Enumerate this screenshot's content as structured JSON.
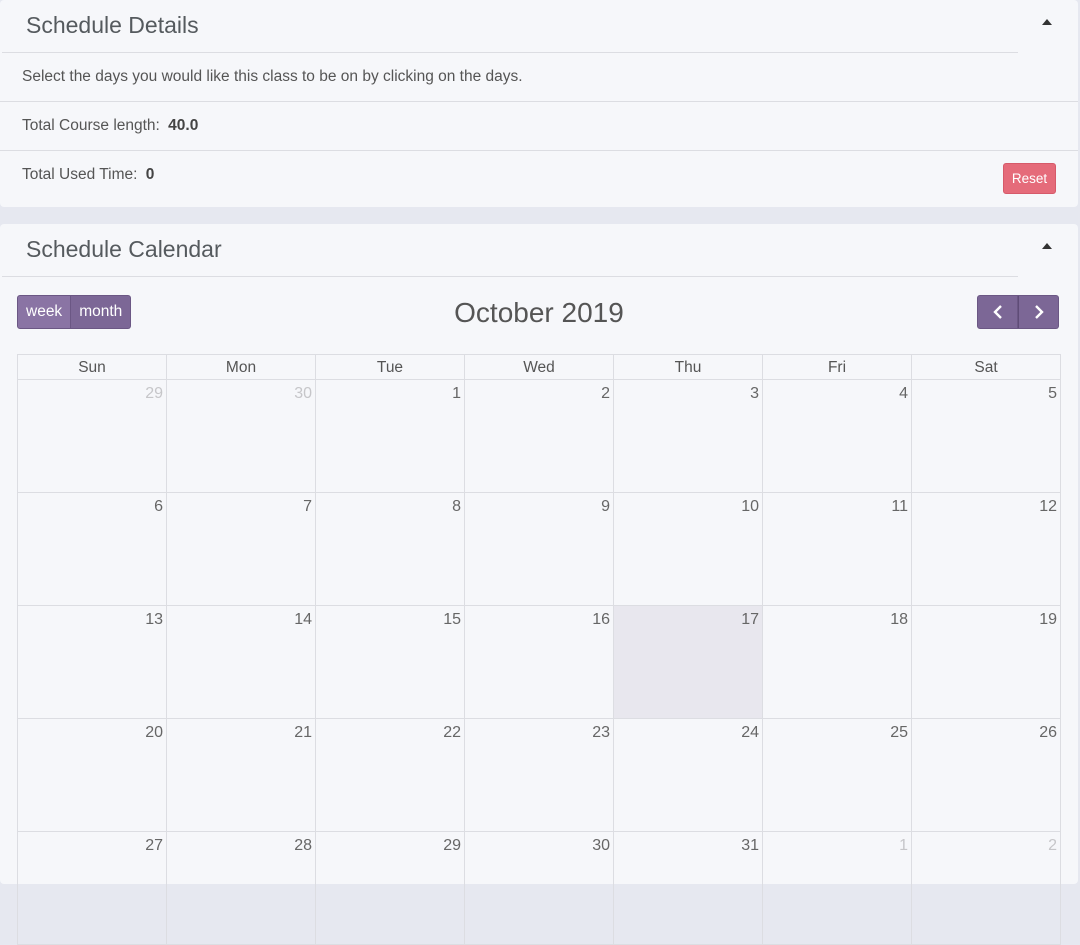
{
  "details": {
    "title": "Schedule Details",
    "instruction": "Select the days you would like this class to be on by clicking on the days.",
    "course_length_label": "Total Course length:",
    "course_length_value": "40.0",
    "used_time_label": "Total Used Time:",
    "used_time_value": "0",
    "reset_label": "Reset"
  },
  "calendar": {
    "title": "Schedule Calendar",
    "view_week": "week",
    "view_month": "month",
    "month_title": "October 2019",
    "prev_icon": "chevron-left-icon",
    "next_icon": "chevron-right-icon",
    "weekdays": [
      "Sun",
      "Mon",
      "Tue",
      "Wed",
      "Thu",
      "Fri",
      "Sat"
    ],
    "weeks": [
      [
        {
          "d": "29",
          "other": true
        },
        {
          "d": "30",
          "other": true
        },
        {
          "d": "1"
        },
        {
          "d": "2"
        },
        {
          "d": "3"
        },
        {
          "d": "4"
        },
        {
          "d": "5"
        }
      ],
      [
        {
          "d": "6"
        },
        {
          "d": "7"
        },
        {
          "d": "8"
        },
        {
          "d": "9"
        },
        {
          "d": "10"
        },
        {
          "d": "11"
        },
        {
          "d": "12"
        }
      ],
      [
        {
          "d": "13"
        },
        {
          "d": "14"
        },
        {
          "d": "15"
        },
        {
          "d": "16"
        },
        {
          "d": "17",
          "today": true
        },
        {
          "d": "18"
        },
        {
          "d": "19"
        }
      ],
      [
        {
          "d": "20"
        },
        {
          "d": "21"
        },
        {
          "d": "22"
        },
        {
          "d": "23"
        },
        {
          "d": "24"
        },
        {
          "d": "25"
        },
        {
          "d": "26"
        }
      ],
      [
        {
          "d": "27"
        },
        {
          "d": "28"
        },
        {
          "d": "29"
        },
        {
          "d": "30"
        },
        {
          "d": "31"
        },
        {
          "d": "1",
          "other": true
        },
        {
          "d": "2",
          "other": true
        }
      ]
    ]
  },
  "colors": {
    "accent": "#7c6796",
    "reset": "#e56b7a",
    "today_highlight": "#e8e7ee"
  }
}
